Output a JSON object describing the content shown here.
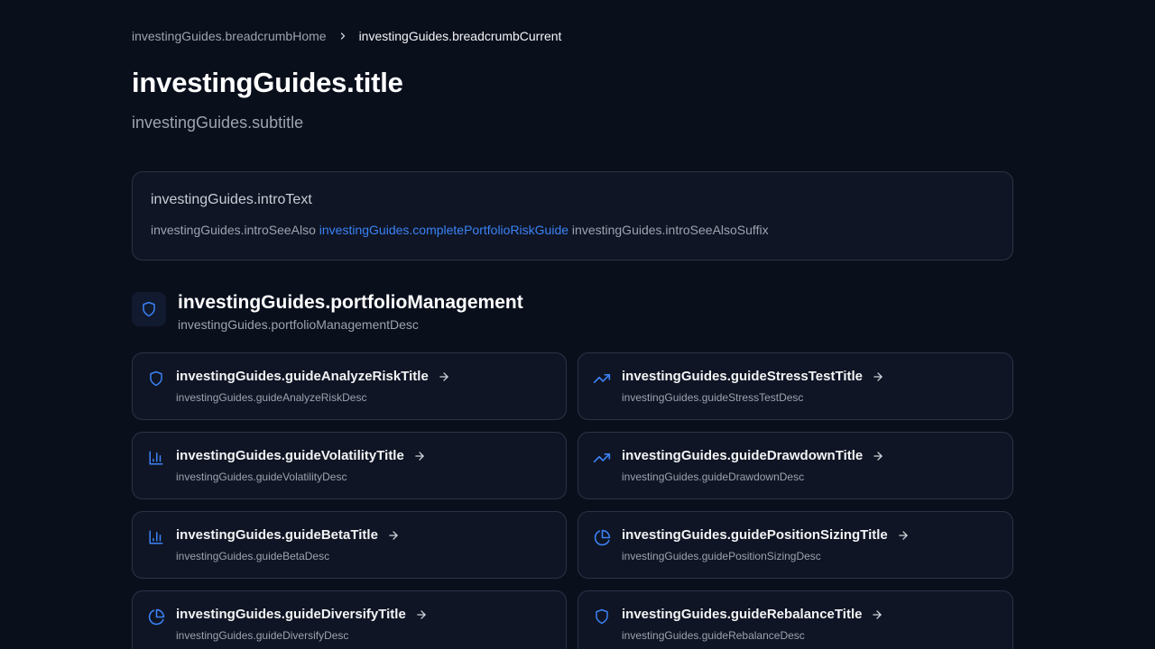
{
  "breadcrumb": {
    "home": "investingGuides.breadcrumbHome",
    "current": "investingGuides.breadcrumbCurrent"
  },
  "header": {
    "title": "investingGuides.title",
    "subtitle": "investingGuides.subtitle"
  },
  "intro": {
    "text": "investingGuides.introText",
    "see_also": "investingGuides.introSeeAlso",
    "link": "investingGuides.completePortfolioRiskGuide",
    "see_also_suffix": "investingGuides.introSeeAlsoSuffix"
  },
  "section": {
    "title": "investingGuides.portfolioManagement",
    "desc": "investingGuides.portfolioManagementDesc",
    "icon": "shield-icon"
  },
  "guides": [
    {
      "title": "investingGuides.guideAnalyzeRiskTitle",
      "desc": "investingGuides.guideAnalyzeRiskDesc",
      "icon": "shield-icon"
    },
    {
      "title": "investingGuides.guideStressTestTitle",
      "desc": "investingGuides.guideStressTestDesc",
      "icon": "trending-up-icon"
    },
    {
      "title": "investingGuides.guideVolatilityTitle",
      "desc": "investingGuides.guideVolatilityDesc",
      "icon": "bar-chart-icon"
    },
    {
      "title": "investingGuides.guideDrawdownTitle",
      "desc": "investingGuides.guideDrawdownDesc",
      "icon": "trending-up-icon"
    },
    {
      "title": "investingGuides.guideBetaTitle",
      "desc": "investingGuides.guideBetaDesc",
      "icon": "bar-chart-icon"
    },
    {
      "title": "investingGuides.guidePositionSizingTitle",
      "desc": "investingGuides.guidePositionSizingDesc",
      "icon": "pie-chart-icon"
    },
    {
      "title": "investingGuides.guideDiversifyTitle",
      "desc": "investingGuides.guideDiversifyDesc",
      "icon": "pie-chart-icon"
    },
    {
      "title": "investingGuides.guideRebalanceTitle",
      "desc": "investingGuides.guideRebalanceDesc",
      "icon": "shield-icon"
    }
  ],
  "colors": {
    "accent": "#3b82f6",
    "background": "#0a0f1c",
    "card": "#0f1524",
    "border": "#2a3346"
  }
}
